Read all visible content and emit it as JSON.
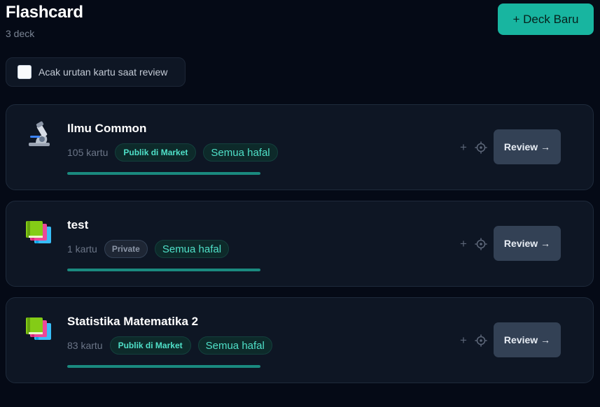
{
  "header": {
    "title": "Flashcard",
    "subtitle": "3 deck",
    "new_deck_label": "+ Deck Baru"
  },
  "shuffle": {
    "label": "Acak urutan kartu saat review",
    "checked": false
  },
  "decks": [
    {
      "icon": "microscope-icon",
      "title": "Ilmu Common",
      "count": "105 kartu",
      "visibility": "Publik di Market",
      "status": "Semua hafal",
      "progress": 1.0,
      "add_label": "+",
      "review_label": "Review →"
    },
    {
      "icon": "books-icon",
      "title": "test",
      "count": "1 kartu",
      "visibility": "Private",
      "status": "Semua hafal",
      "progress": 1.0,
      "add_label": "+",
      "review_label": "Review →"
    },
    {
      "icon": "books-icon",
      "title": "Statistika Matematika 2",
      "count": "83 kartu",
      "visibility": "Publik di Market",
      "status": "Semua hafal",
      "progress": 1.0,
      "add_label": "+",
      "review_label": "Review →"
    }
  ],
  "colors": {
    "background": "#050a16",
    "accent": "#18b5a0",
    "badge_text": "#4fe0c8",
    "progress": "#1a8a7f"
  }
}
